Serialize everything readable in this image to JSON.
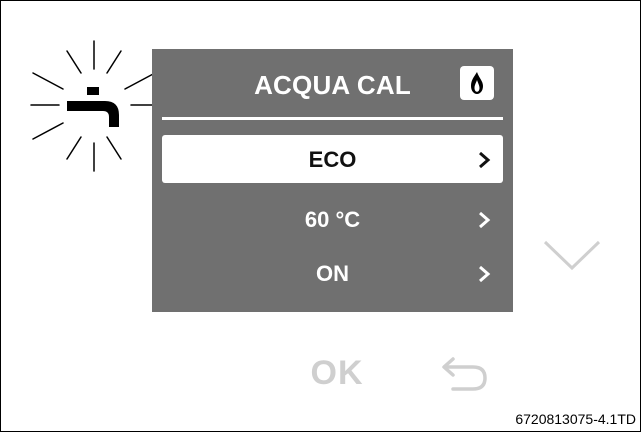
{
  "screen": {
    "title": "ACQUA CAL",
    "header_icon": "flame-icon",
    "menu_items": [
      {
        "label": "ECO",
        "selected": true,
        "icon": "chevron-right-icon"
      },
      {
        "label": "60 °C",
        "selected": false,
        "icon": "chevron-right-icon"
      },
      {
        "label": "ON",
        "selected": false,
        "icon": "chevron-right-icon"
      }
    ]
  },
  "status_indicator": {
    "icon": "hot-water-tap-icon",
    "state": "blinking"
  },
  "controls": {
    "down_icon": "chevron-down-icon",
    "ok_label": "OK",
    "back_icon": "back-arrow-icon"
  },
  "figure_id": "6720813075-4.1TD",
  "colors": {
    "screen_bg": "#707070",
    "selected_row_bg": "#ffffff",
    "text_light": "#ffffff",
    "text_dark": "#111111",
    "inactive_control": "#cfcfcf"
  }
}
